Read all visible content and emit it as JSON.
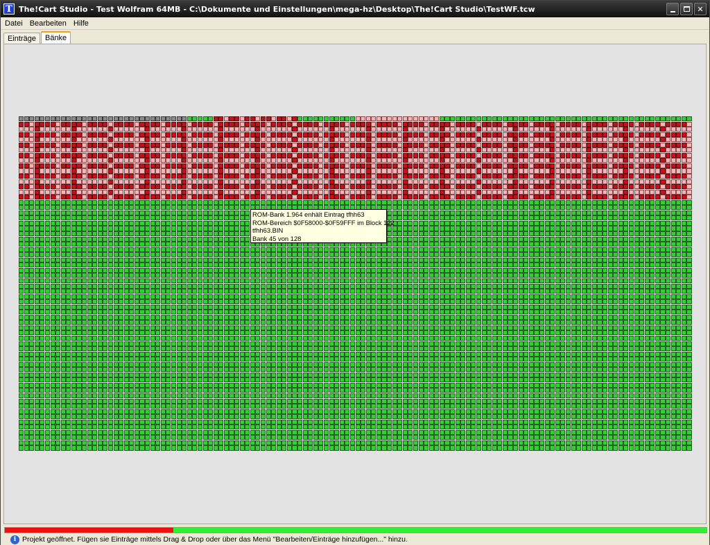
{
  "window": {
    "title": "The!Cart Studio - Test Wolfram 64MB - C:\\Dokumente und Einstellungen\\mega-hz\\Desktop\\The!Cart Studio\\TestWF.tcw",
    "icon_letter": "T",
    "controls": [
      "minimize-icon",
      "maximize-icon",
      "close-icon"
    ]
  },
  "menu": {
    "items": [
      "Datei",
      "Bearbeiten",
      "Hilfe"
    ]
  },
  "tabs": [
    {
      "label": "Einträge",
      "active": false
    },
    {
      "label": "Bänke",
      "active": true
    }
  ],
  "bank_grid": {
    "columns": 128,
    "rows": 64,
    "colors": {
      "used": "#c8101a",
      "partial": "#f2b6b8",
      "free": "#2fd22f",
      "reserved": "#8a8a8a"
    }
  },
  "tooltip": {
    "lines": [
      "ROM-Bank 1.964 enhält Eintrag tfhh63",
      "ROM-Bereich $0F58000-$0F59FFF im Block 122",
      "tfhh63.BIN",
      "Bank 45 von 128"
    ]
  },
  "progress": {
    "used_fraction": 0.24,
    "used_color": "#ee1111",
    "free_color": "#33ee33"
  },
  "status": {
    "icon": "info-icon",
    "text": "Projekt geöffnet. Fügen sie Einträge mittels Drag & Drop oder über das Menü \"Bearbeiten/Einträge hinzufügen...\" hinzu."
  }
}
